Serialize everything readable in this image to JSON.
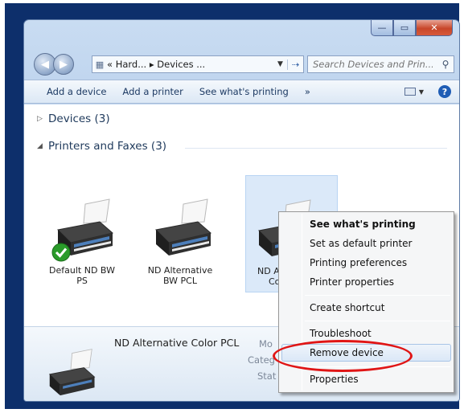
{
  "window": {
    "controls": {
      "minimize": "—",
      "maximize": "▭",
      "close": "✕"
    }
  },
  "nav": {
    "back_glyph": "◀",
    "forward_glyph": "▶",
    "address_path": "« Hard... ▸ Devices ...",
    "search_placeholder": "Search Devices and Prin..."
  },
  "toolbar": {
    "items": [
      "Add a device",
      "Add a printer",
      "See what's printing",
      "»"
    ]
  },
  "groups": {
    "devices": "Devices (3)",
    "printers": "Printers and Faxes (3)"
  },
  "printers": [
    {
      "label_line1": "Default ND BW",
      "label_line2": "PS",
      "default": true
    },
    {
      "label_line1": "ND Alternative",
      "label_line2": "BW PCL",
      "default": false
    },
    {
      "label_line1": "ND A",
      "label_line2": "Co",
      "default": false,
      "selected": true
    }
  ],
  "details": {
    "name": "ND Alternative Color PCL",
    "label_model": "Mo",
    "label_category": "Categ",
    "label_status": "Stat"
  },
  "context_menu": {
    "items": [
      {
        "label": "See what's printing",
        "bold": true
      },
      {
        "label": "Set as default printer"
      },
      {
        "label": "Printing preferences"
      },
      {
        "label": "Printer properties"
      },
      {
        "label": "Create shortcut"
      },
      {
        "label": "Troubleshoot"
      },
      {
        "label": "Remove device",
        "highlighted": true
      },
      {
        "label": "Properties"
      }
    ]
  },
  "colors": {
    "highlight_circle": "#e01515",
    "desktop": "#0d2f6b",
    "default_check": "#2a9b2a"
  }
}
